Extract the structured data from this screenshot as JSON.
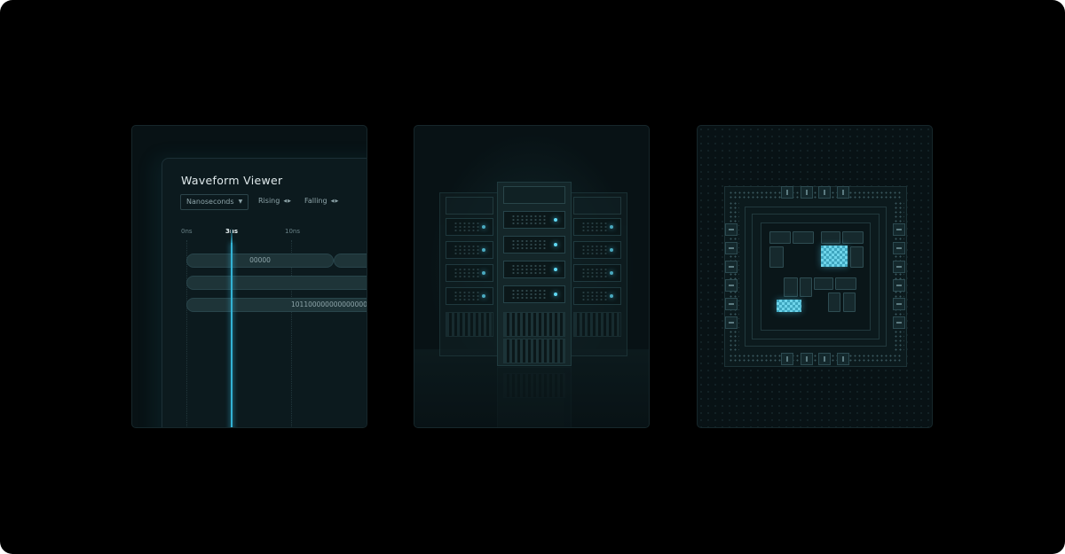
{
  "colors": {
    "background": "#000000",
    "card": "#081215",
    "accent": "#33b2d4",
    "led": "#5fd9f5"
  },
  "waveform": {
    "title": "Waveform Viewer",
    "unit_select": "Nanoseconds",
    "rising_label": "Rising",
    "falling_label": "Falling",
    "ticks": [
      "0ns",
      "3ns",
      "10ns"
    ],
    "signals": [
      {
        "value": "00000"
      },
      {
        "value": ""
      },
      {
        "value": "10110000000000000000"
      }
    ],
    "icons": {
      "select": "chevron-down-icon",
      "step": "left-right-arrows-icon"
    }
  },
  "server": {
    "icon": "server-rack-illustration"
  },
  "chip": {
    "icon": "chip-die-illustration"
  }
}
